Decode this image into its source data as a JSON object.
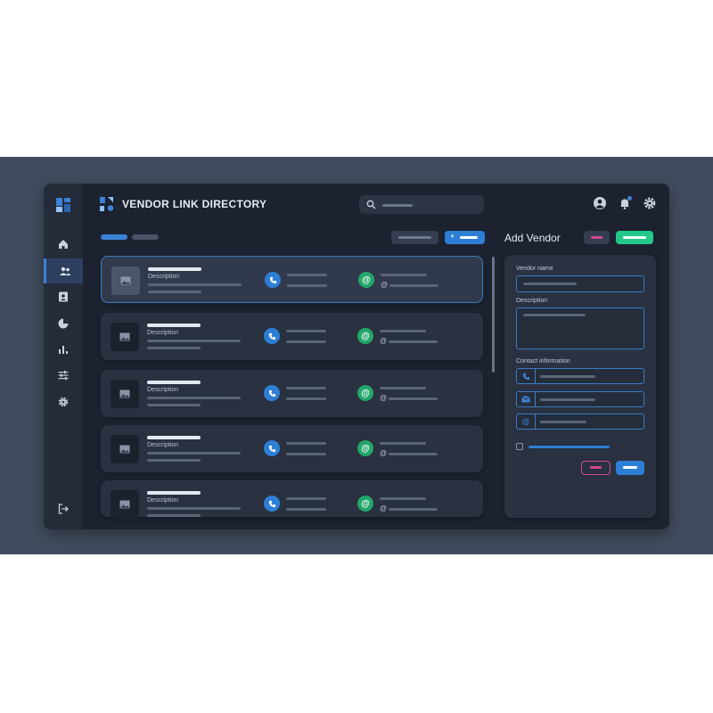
{
  "app": {
    "title": "VENDOR LINK DIRECTORY"
  },
  "sidebar": {
    "items": [
      {
        "icon": "home-icon"
      },
      {
        "icon": "users-icon",
        "active": true
      },
      {
        "icon": "contacts-icon"
      },
      {
        "icon": "pie-icon"
      },
      {
        "icon": "bar-chart-icon"
      },
      {
        "icon": "sliders-icon"
      },
      {
        "icon": "gear-icon"
      }
    ],
    "logout_icon": "logout-icon"
  },
  "search": {
    "icon": "search-icon"
  },
  "vendors": [
    {
      "description_label": "Description",
      "selected": true
    },
    {
      "description_label": "Description",
      "selected": false
    },
    {
      "description_label": "Description",
      "selected": false
    },
    {
      "description_label": "Description",
      "selected": false
    },
    {
      "description_label": "Description",
      "selected": false
    }
  ],
  "toolbar": {
    "add_symbol": "+"
  },
  "panel": {
    "title": "Add Vendor",
    "vendor_name_label": "Vendor name",
    "description_label": "Description",
    "contact_label": "Contact information"
  },
  "colors": {
    "accent": "#3b82d6",
    "success": "#22c98a",
    "danger": "#d04a8a",
    "app_bg": "#1c2230"
  }
}
